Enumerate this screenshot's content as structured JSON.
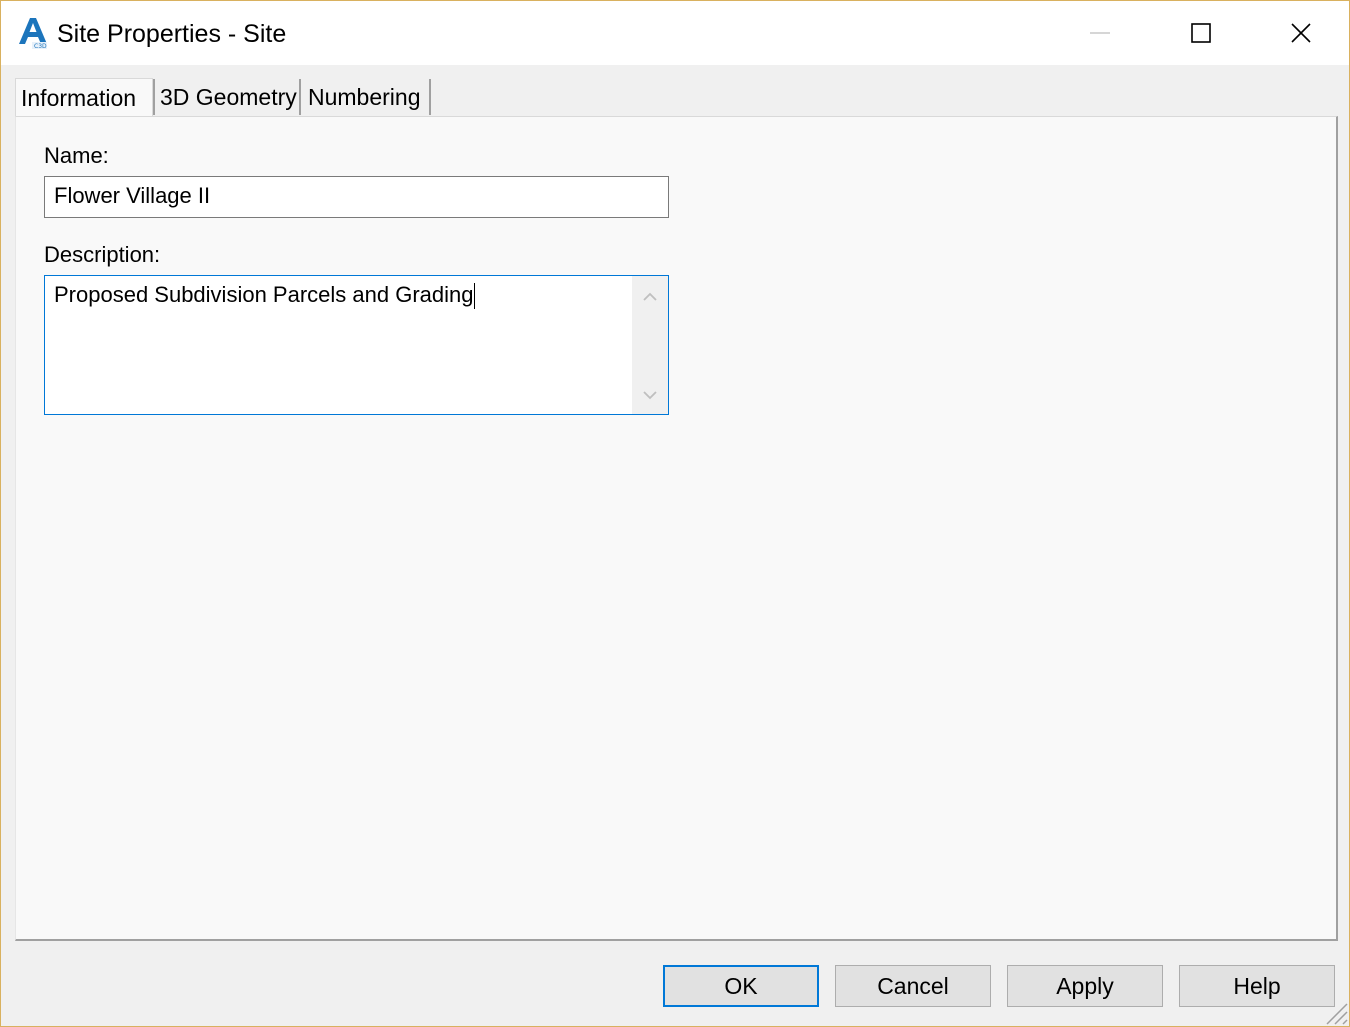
{
  "window": {
    "title": "Site Properties - Site",
    "app_icon": "autocad-civil3d-icon",
    "controls": [
      "minimize-icon",
      "maximize-icon",
      "close-icon"
    ]
  },
  "tabs": [
    {
      "label": "Information",
      "active": true
    },
    {
      "label": "3D Geometry",
      "active": false
    },
    {
      "label": "Numbering",
      "active": false
    }
  ],
  "form": {
    "name_label": "Name:",
    "name_value": "Flower Village II",
    "description_label": "Description:",
    "description_value": "Proposed Subdivision Parcels and Grading"
  },
  "buttons": {
    "ok": "OK",
    "cancel": "Cancel",
    "apply": "Apply",
    "help": "Help"
  },
  "colors": {
    "accent": "#0078d7",
    "app_icon_blue": "#1c75bc"
  }
}
